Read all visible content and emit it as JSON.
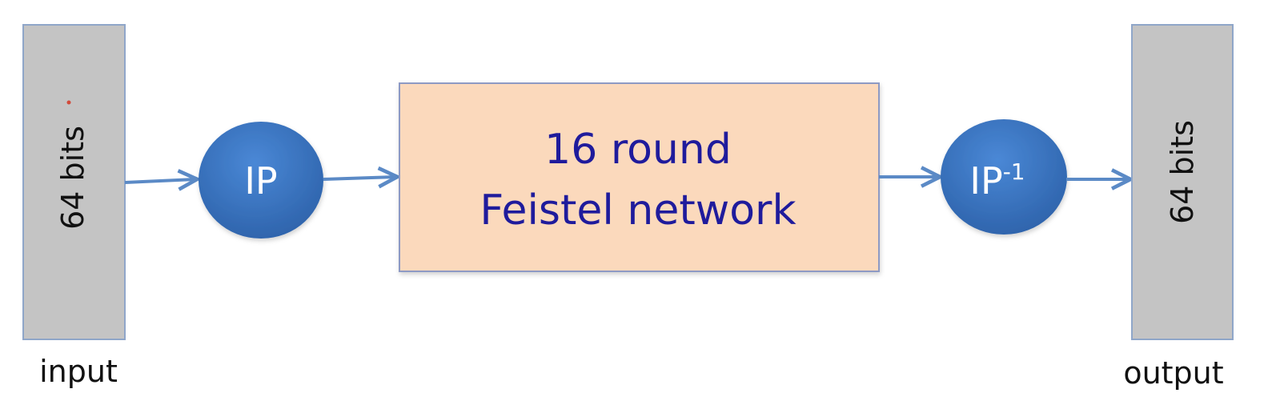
{
  "diagram": {
    "input_block": {
      "label": "64  bits",
      "caption": "input"
    },
    "initial_permutation": {
      "label": "IP"
    },
    "feistel_block": {
      "line1": "16 round",
      "line2": "Feistel network"
    },
    "inverse_permutation": {
      "label": "IP",
      "superscript": "-1"
    },
    "output_block": {
      "label": "64  bits",
      "caption": "output"
    },
    "colors": {
      "bit_block_fill": "#c4c4c4",
      "bit_block_stroke": "#8fa6c9",
      "node_fill": "#3a76c4",
      "node_fill_dark": "#2e63ab",
      "feistel_fill": "#fbd9bc",
      "feistel_stroke": "#8e9ac4",
      "feistel_text": "#1f1b9c",
      "arrow": "#5b8ac6"
    }
  }
}
